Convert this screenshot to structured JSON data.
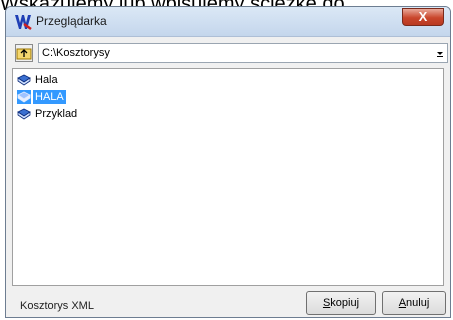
{
  "caption": "Wskazujemy lub wpisujemy ścieżkę do",
  "window": {
    "title": "Przeglądarka",
    "close_label": "X"
  },
  "path": {
    "value": "C:\\Kosztorysy"
  },
  "items": [
    {
      "label": "Hala",
      "icon": "book-icon",
      "selected": false
    },
    {
      "label": "HALA",
      "icon": "book-icon",
      "selected": true
    },
    {
      "label": "Przyklad",
      "icon": "book-icon",
      "selected": false
    }
  ],
  "status": {
    "format_label": "Kosztorys XML"
  },
  "buttons": {
    "copy_first": "S",
    "copy_rest": "kopiuj",
    "cancel_first": "A",
    "cancel_rest": "nuluj"
  },
  "colors": {
    "selection": "#3399ff",
    "close_button": "#c9462c"
  }
}
